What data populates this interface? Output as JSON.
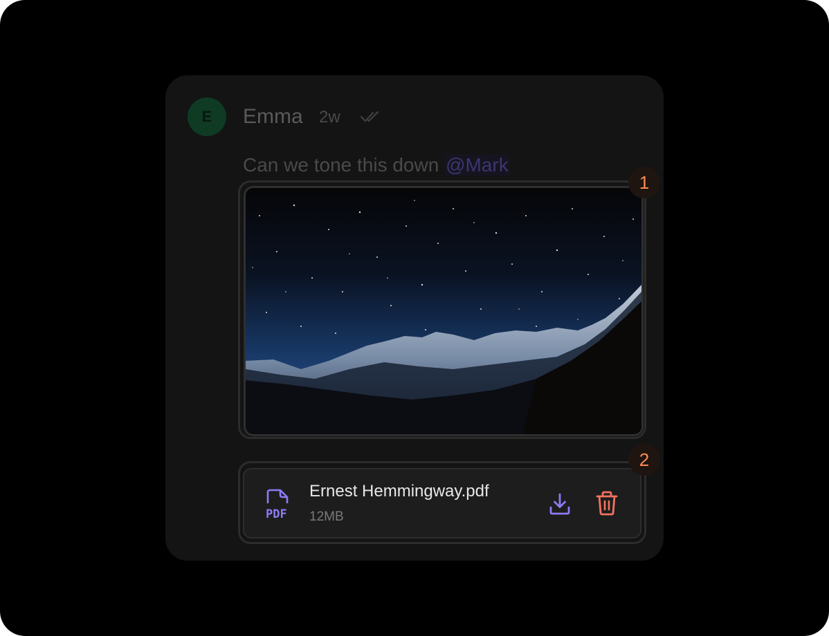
{
  "message": {
    "author": "Emma",
    "avatar_initial": "E",
    "time": "2w",
    "status_icon": "double-check-icon",
    "text": "Can we tone this down ",
    "mention": "@Mark"
  },
  "attachments": {
    "image": {
      "badge": "1",
      "description_icon": "night-mountain-photo",
      "download_icon": "download-icon",
      "close_icon": "close-icon"
    },
    "file": {
      "badge": "2",
      "type_icon": "pdf-file-icon",
      "type_label": "PDF",
      "name": "Ernest Hemmingway.pdf",
      "size": "12MB",
      "download_icon": "download-icon",
      "delete_icon": "trash-icon"
    }
  },
  "colors": {
    "background": "#000000",
    "card": "#141414",
    "accent_purple": "#8b7cf6",
    "delete_red": "#f2735f",
    "badge_orange": "#ff8a53",
    "avatar_green": "#0f3b25"
  }
}
